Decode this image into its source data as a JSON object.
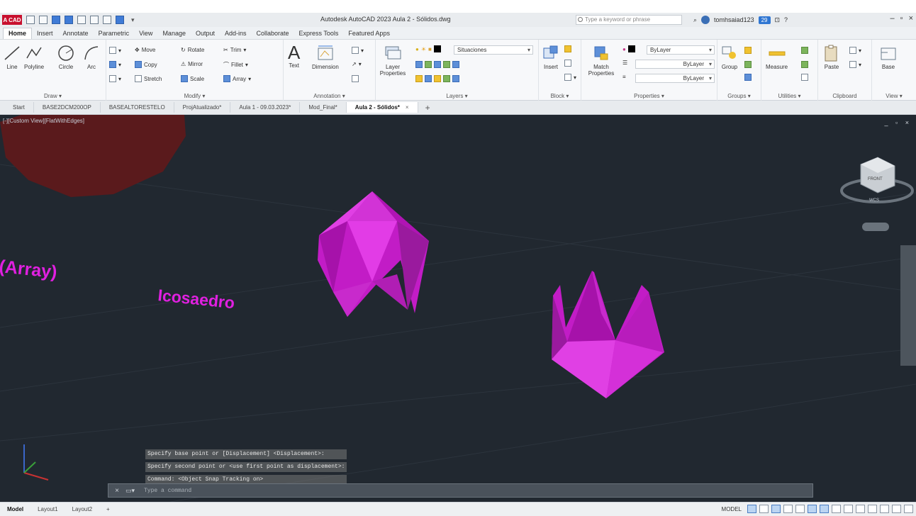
{
  "app": {
    "logo_label": "A CAD",
    "title": "Autodesk AutoCAD 2023   Aula 2 - Sólidos.dwg",
    "search_placeholder": "Type a keyword or phrase",
    "user_name": "tomhsaiad123",
    "badge": "29"
  },
  "ribbon_tabs": [
    "Home",
    "Insert",
    "Annotate",
    "Parametric",
    "View",
    "Manage",
    "Output",
    "Add-ins",
    "Collaborate",
    "Express Tools",
    "Featured Apps"
  ],
  "ribbon": {
    "draw": {
      "title": "Draw ▾",
      "tools": [
        "Line",
        "Polyline",
        "Circle",
        "Arc"
      ]
    },
    "modify": {
      "title": "Modify ▾",
      "move": "Move",
      "rotate": "Rotate",
      "trim": "Trim",
      "copy": "Copy",
      "mirror": "Mirror",
      "fillet": "Fillet",
      "stretch": "Stretch",
      "scale": "Scale",
      "array": "Array"
    },
    "annotation": {
      "title": "Annotation ▾",
      "text": "Text",
      "dimension": "Dimension"
    },
    "layers": {
      "title": "Layers ▾",
      "properties": "Layer Properties",
      "current_layer": "Situaciones"
    },
    "block": {
      "title": "Block ▾",
      "insert": "Insert"
    },
    "properties": {
      "title": "Properties ▾",
      "match": "Match Properties",
      "color": "ByLayer",
      "linetype": "ByLayer",
      "lineweight": "ByLayer"
    },
    "groups": {
      "title": "Groups ▾",
      "group": "Group"
    },
    "utilities": {
      "title": "Utilities ▾",
      "measure": "Measure"
    },
    "clipboard": {
      "title": "Clipboard",
      "paste": "Paste"
    },
    "view": {
      "title": "View ▾",
      "base": "Base"
    }
  },
  "doc_tabs": [
    {
      "label": "Start"
    },
    {
      "label": "BASE2DCM200OP"
    },
    {
      "label": "BASEALTORESTELO"
    },
    {
      "label": "ProjAtualizado*"
    },
    {
      "label": "Aula 1 - 09.03.2023*"
    },
    {
      "label": "Mod_Final*"
    },
    {
      "label": "Aula 2 - Sólidos*"
    }
  ],
  "viewport": {
    "label": "[-][Custom View][FlatWithEdges]",
    "controls": "_ ▫ ×",
    "scene_text_1": "(Array)",
    "scene_text_2": "Icosaedro",
    "nav_cube_face": "FRONT",
    "nav_wcs": "WCS",
    "accent_color": "#e020e0"
  },
  "command": {
    "history": [
      "Specify base point or [Displacement] <Displacement>:",
      "Specify second point or <use first point as displacement>:",
      "Command:  <Object Snap Tracking on>"
    ],
    "input_placeholder": "Type a command"
  },
  "status": {
    "layout_tabs": [
      "Model",
      "Layout1",
      "Layout2"
    ],
    "space": "MODEL"
  }
}
